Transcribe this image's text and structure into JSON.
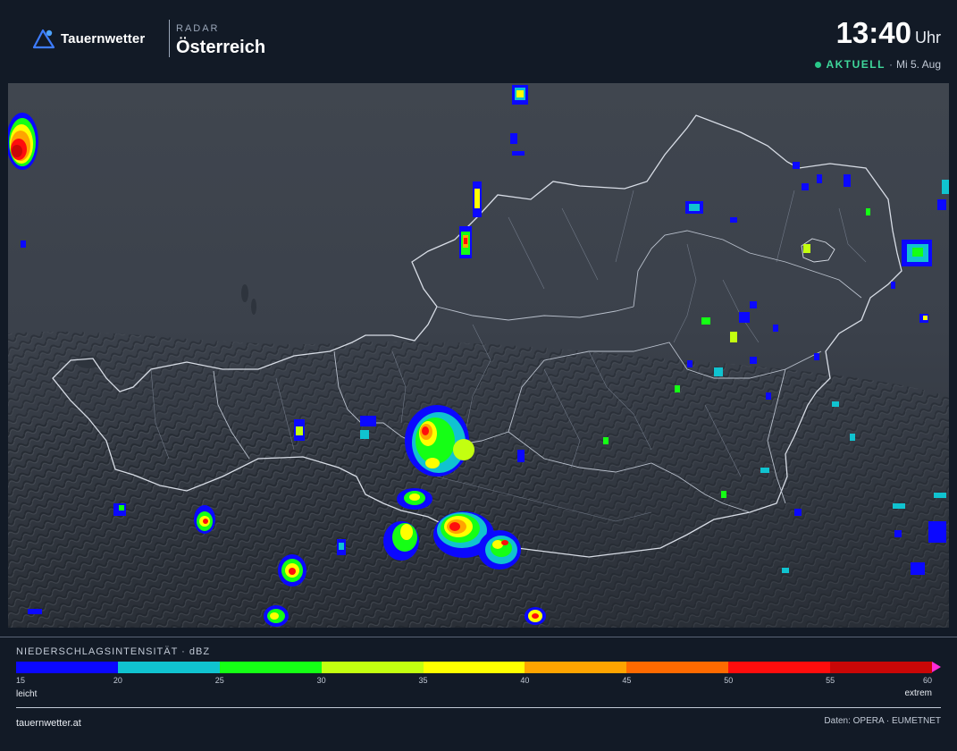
{
  "header": {
    "brand": "Tauernwetter",
    "kicker": "RADAR",
    "region": "Österreich",
    "time": "13:40",
    "time_unit": "Uhr",
    "status": "AKTUELL",
    "separator": "·",
    "date": "Mi 5. Aug"
  },
  "colors": {
    "background": "#121a26",
    "status_live": "#3fd79b",
    "map_base": "#3a404b",
    "scale_arrow": "#ff2bd6"
  },
  "legend": {
    "title": "NIEDERSCHLAGSINTENSITÄT · dBZ",
    "low_label": "leicht",
    "high_label": "extrem",
    "ticks": [
      "15",
      "20",
      "25",
      "30",
      "35",
      "40",
      "45",
      "50",
      "55",
      "60"
    ],
    "colors": [
      "#0b08ff",
      "#10c3d0",
      "#15ff15",
      "#c3ff10",
      "#ffff00",
      "#ffa400",
      "#ff6a00",
      "#ff0d0d",
      "#c90707"
    ]
  },
  "footer": {
    "site": "tauernwetter.at",
    "credits": "Daten: OPERA · EUMETNET"
  }
}
